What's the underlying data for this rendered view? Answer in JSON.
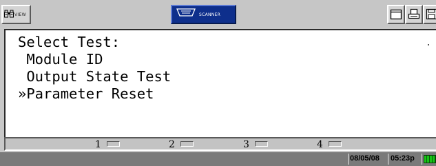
{
  "toolbar": {
    "view_label": "VIEW",
    "scanner_label": "SCANNER",
    "icons": [
      "binoculars-icon",
      "connector-icon",
      "window-icon",
      "printer-icon",
      "save-icon"
    ],
    "accent_color": "#0e2f8c"
  },
  "screen": {
    "title": "Select Test:",
    "items": [
      {
        "label": " Module ID"
      },
      {
        "label": " Output State Test"
      },
      {
        "label": "»Parameter Reset"
      }
    ]
  },
  "function_keys": [
    "1",
    "2",
    "3",
    "4"
  ],
  "status": {
    "date": "08/05/08",
    "time": "05:23p",
    "battery_color": "#17c417"
  }
}
